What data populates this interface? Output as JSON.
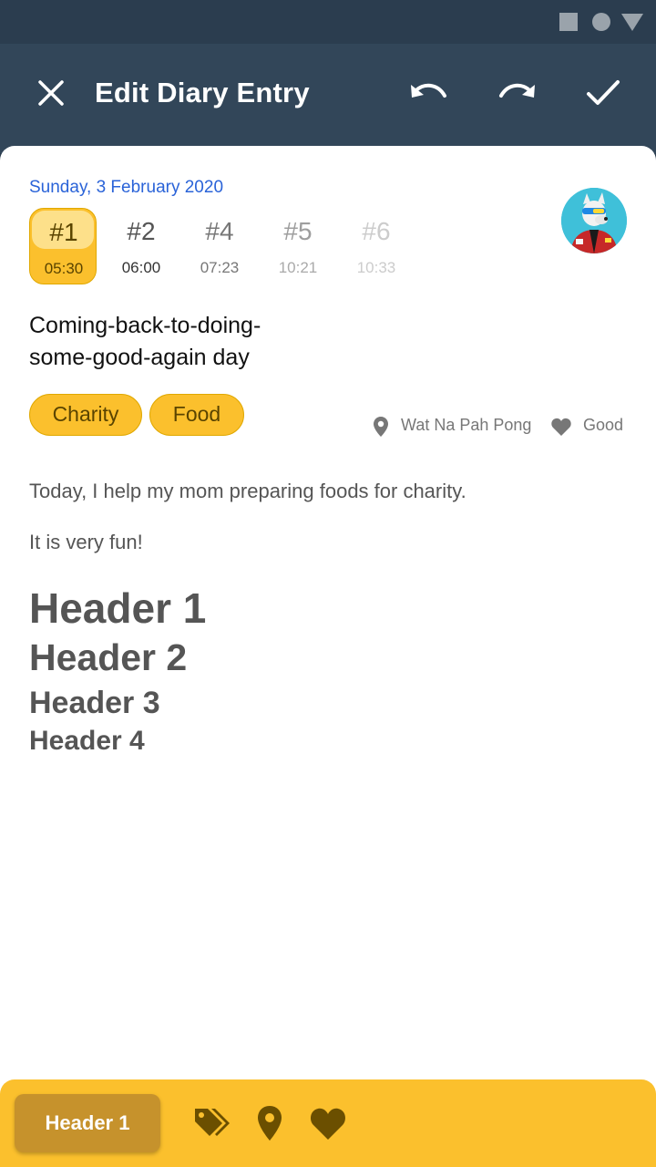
{
  "appbar": {
    "title": "Edit Diary Entry"
  },
  "entry": {
    "date": "Sunday, 3 February 2020",
    "tabs": [
      {
        "number": "#1",
        "time": "05:30"
      },
      {
        "number": "#2",
        "time": "06:00"
      },
      {
        "number": "#4",
        "time": "07:23"
      },
      {
        "number": "#5",
        "time": "10:21"
      },
      {
        "number": "#6",
        "time": "10:33"
      }
    ],
    "headline_line1": "Coming-back-to-doing-",
    "headline_line2": "some-good-again day",
    "tags": [
      "Charity",
      "Food"
    ],
    "location": "Wat Na Pah Pong",
    "mood": "Good"
  },
  "content": {
    "paragraph1": "Today, I help my mom preparing foods for charity.",
    "paragraph2": "It is very fun!",
    "header1": "Header 1",
    "header2": "Header 2",
    "header3": "Header 3",
    "header4": "Header 4"
  },
  "toolbar": {
    "style_label": "Header 1"
  },
  "colors": {
    "appbar": "#324659",
    "accent": "#fbc02d",
    "date": "#2a63d8"
  }
}
